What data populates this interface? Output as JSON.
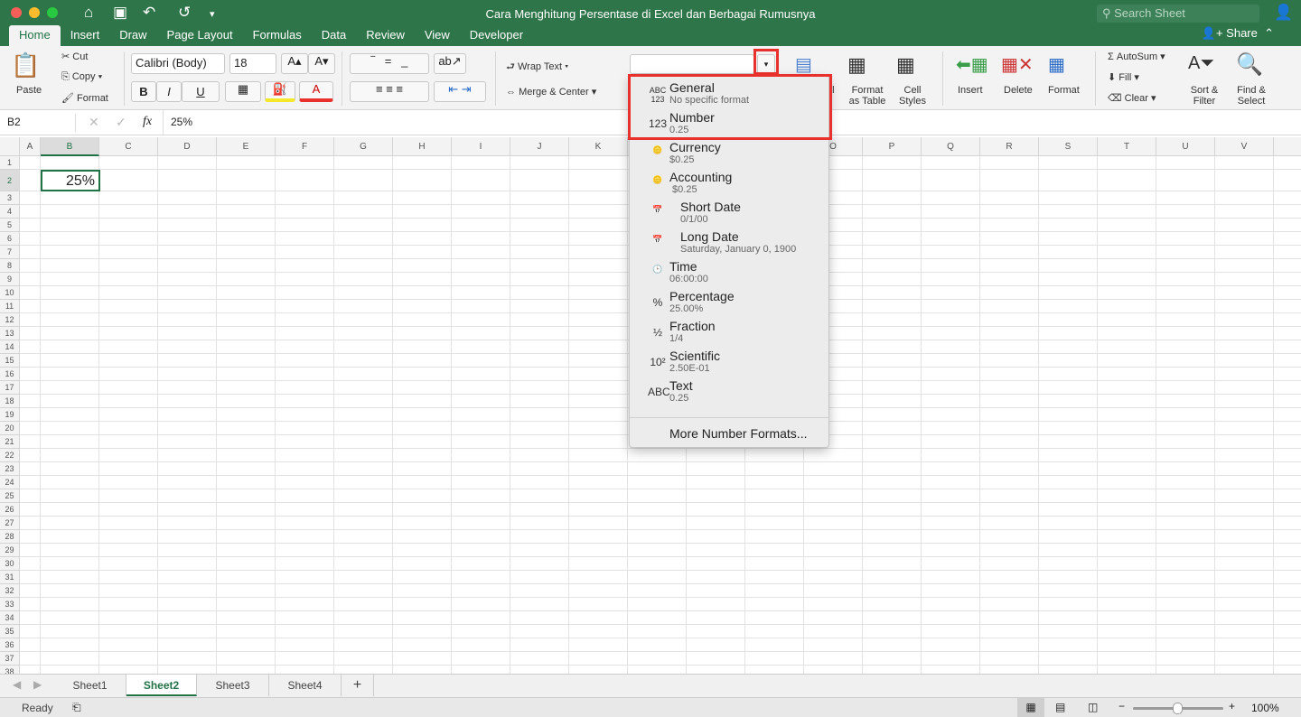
{
  "window": {
    "title": "Cara Menghitung Persentase di Excel dan Berbagai Rumusnya",
    "search_placeholder": "Search Sheet",
    "share": "Share"
  },
  "tabs": [
    "Home",
    "Insert",
    "Draw",
    "Page Layout",
    "Formulas",
    "Data",
    "Review",
    "View",
    "Developer"
  ],
  "ribbon": {
    "paste": "Paste",
    "cut": "Cut",
    "copy": "Copy",
    "format_painter": "Format",
    "font": "Calibri (Body)",
    "size": "18",
    "bold": "B",
    "italic": "I",
    "underline": "U",
    "wrap": "Wrap Text",
    "merge": "Merge & Center",
    "cond_fmt": "al\ng",
    "format_table": "Format as Table",
    "cell_styles": "Cell Styles",
    "insert": "Insert",
    "delete": "Delete",
    "format": "Format",
    "autosum": "AutoSum",
    "fill": "Fill",
    "clear": "Clear",
    "sort": "Sort & Filter",
    "find": "Find & Select",
    "number_format_value": ""
  },
  "formula_bar": {
    "name_box": "B2",
    "fx": "fx",
    "value": "25%"
  },
  "columns": [
    "A",
    "B",
    "C",
    "D",
    "E",
    "F",
    "G",
    "H",
    "I",
    "J",
    "K",
    "L",
    "M",
    "N",
    "O",
    "P",
    "Q",
    "R",
    "S",
    "T",
    "U",
    "V"
  ],
  "rows": [
    "1",
    "2",
    "3",
    "4",
    "5",
    "6",
    "7",
    "8",
    "9",
    "10",
    "11",
    "12",
    "13",
    "14",
    "15",
    "16",
    "17",
    "18",
    "19",
    "20",
    "21",
    "22",
    "23",
    "24",
    "25",
    "26",
    "27",
    "28",
    "29",
    "30",
    "31",
    "32",
    "33",
    "34",
    "35",
    "36",
    "37",
    "38"
  ],
  "cells": {
    "B2": "25%"
  },
  "format_menu": [
    {
      "icon": "ABC 123",
      "name": "General",
      "example": "No specific format"
    },
    {
      "icon": "123",
      "name": "Number",
      "example": "0.25"
    },
    {
      "icon": "coins",
      "name": "Currency",
      "example": "$0.25"
    },
    {
      "icon": "coins",
      "name": "Accounting",
      "example": " $0.25"
    },
    {
      "icon": "calendar",
      "name": "Short Date",
      "example": "0/1/00"
    },
    {
      "icon": "calendar",
      "name": "Long Date",
      "example": "Saturday, January 0, 1900"
    },
    {
      "icon": "clock",
      "name": "Time",
      "example": "06:00:00"
    },
    {
      "icon": "%",
      "name": "Percentage",
      "example": "25.00%"
    },
    {
      "icon": "½",
      "name": "Fraction",
      "example": "1/4"
    },
    {
      "icon": "10²",
      "name": "Scientific",
      "example": "2.50E-01"
    },
    {
      "icon": "ABC",
      "name": "Text",
      "example": "0.25"
    }
  ],
  "more_formats": "More Number Formats...",
  "sheets": [
    "Sheet1",
    "Sheet2",
    "Sheet3",
    "Sheet4"
  ],
  "active_sheet": "Sheet2",
  "status": {
    "ready": "Ready",
    "zoom": "100%"
  },
  "colors": {
    "accent": "#217346",
    "highlight": "#e8302c"
  }
}
